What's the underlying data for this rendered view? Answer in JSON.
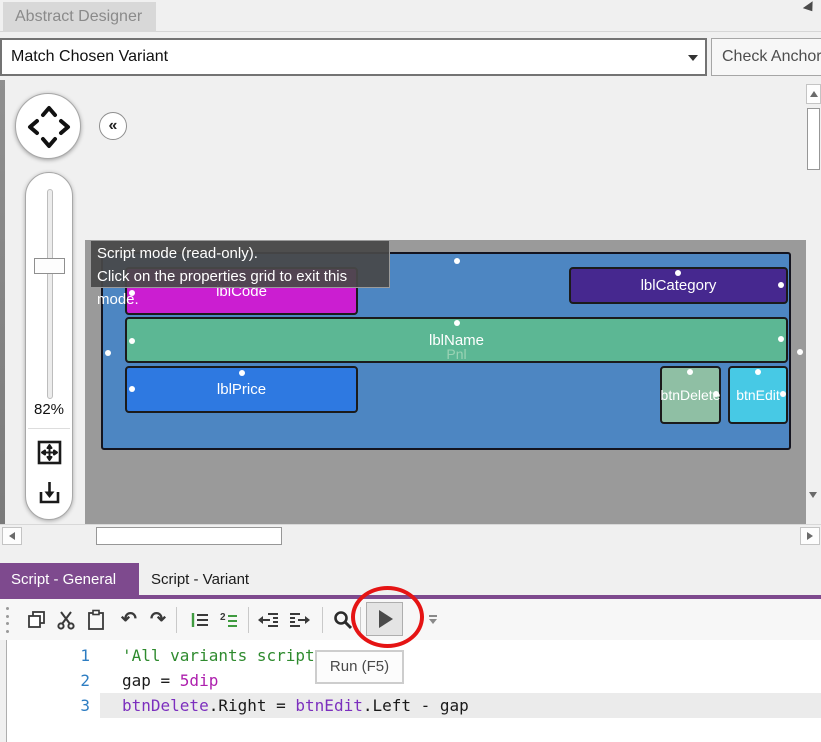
{
  "colors": {
    "accent_purple": "#7e4a8e",
    "annotation_red": "#e51414",
    "canvas_gray": "#9a9a9a",
    "panel_blue": "#4d86c2"
  },
  "top_tab": {
    "label": "Abstract Designer"
  },
  "variant_bar": {
    "combo_value": "Match Chosen Variant",
    "check_anchors_label": "Check Anchors"
  },
  "designer": {
    "zoom_percent": "82%",
    "collapse_glyph": "«",
    "tooltip": {
      "line1": "Script mode (read-only).",
      "line2": "Click on the properties grid to exit this mode."
    },
    "canvas": {
      "parent_panel_label": "Pnl",
      "views": [
        {
          "name": "lblCode",
          "label": "lblCode",
          "color": "#cb1ed1"
        },
        {
          "name": "lblCategory",
          "label": "lblCategory",
          "color": "#46288f"
        },
        {
          "name": "lblName",
          "label": "lblName",
          "color": "#5cb794"
        },
        {
          "name": "lblPrice",
          "label": "lblPrice",
          "color": "#2e79e1"
        },
        {
          "name": "btnDelete",
          "label": "btnDelete",
          "color": "#8fbfa4"
        },
        {
          "name": "btnEdit",
          "label": "btnEdit",
          "color": "#47c9e5"
        }
      ]
    }
  },
  "script_tabs": {
    "general": "Script - General",
    "variant": "Script - Variant"
  },
  "toolbar": {
    "undo_glyph": "↶",
    "redo_glyph": "↷",
    "run_tooltip": "Run (F5)",
    "icons": [
      "copy-icon",
      "cut-icon",
      "paste-icon",
      "undo-icon",
      "redo-icon",
      "comment-icon",
      "uncomment-icon",
      "outdent-icon",
      "indent-icon",
      "search-icon",
      "run-icon",
      "overflow-icon"
    ]
  },
  "editor": {
    "lines": [
      {
        "num": "1",
        "highlight": false,
        "tokens": [
          {
            "t": "'All variants script",
            "c": "comment"
          }
        ]
      },
      {
        "num": "2",
        "highlight": false,
        "tokens": [
          {
            "t": "gap = ",
            "c": "plain"
          },
          {
            "t": "5dip",
            "c": "num"
          }
        ]
      },
      {
        "num": "3",
        "highlight": true,
        "tokens": [
          {
            "t": "btnDelete",
            "c": "ident"
          },
          {
            "t": ".Right = ",
            "c": "plain"
          },
          {
            "t": "btnEdit",
            "c": "ident"
          },
          {
            "t": ".Left - gap",
            "c": "plain"
          }
        ]
      }
    ]
  }
}
